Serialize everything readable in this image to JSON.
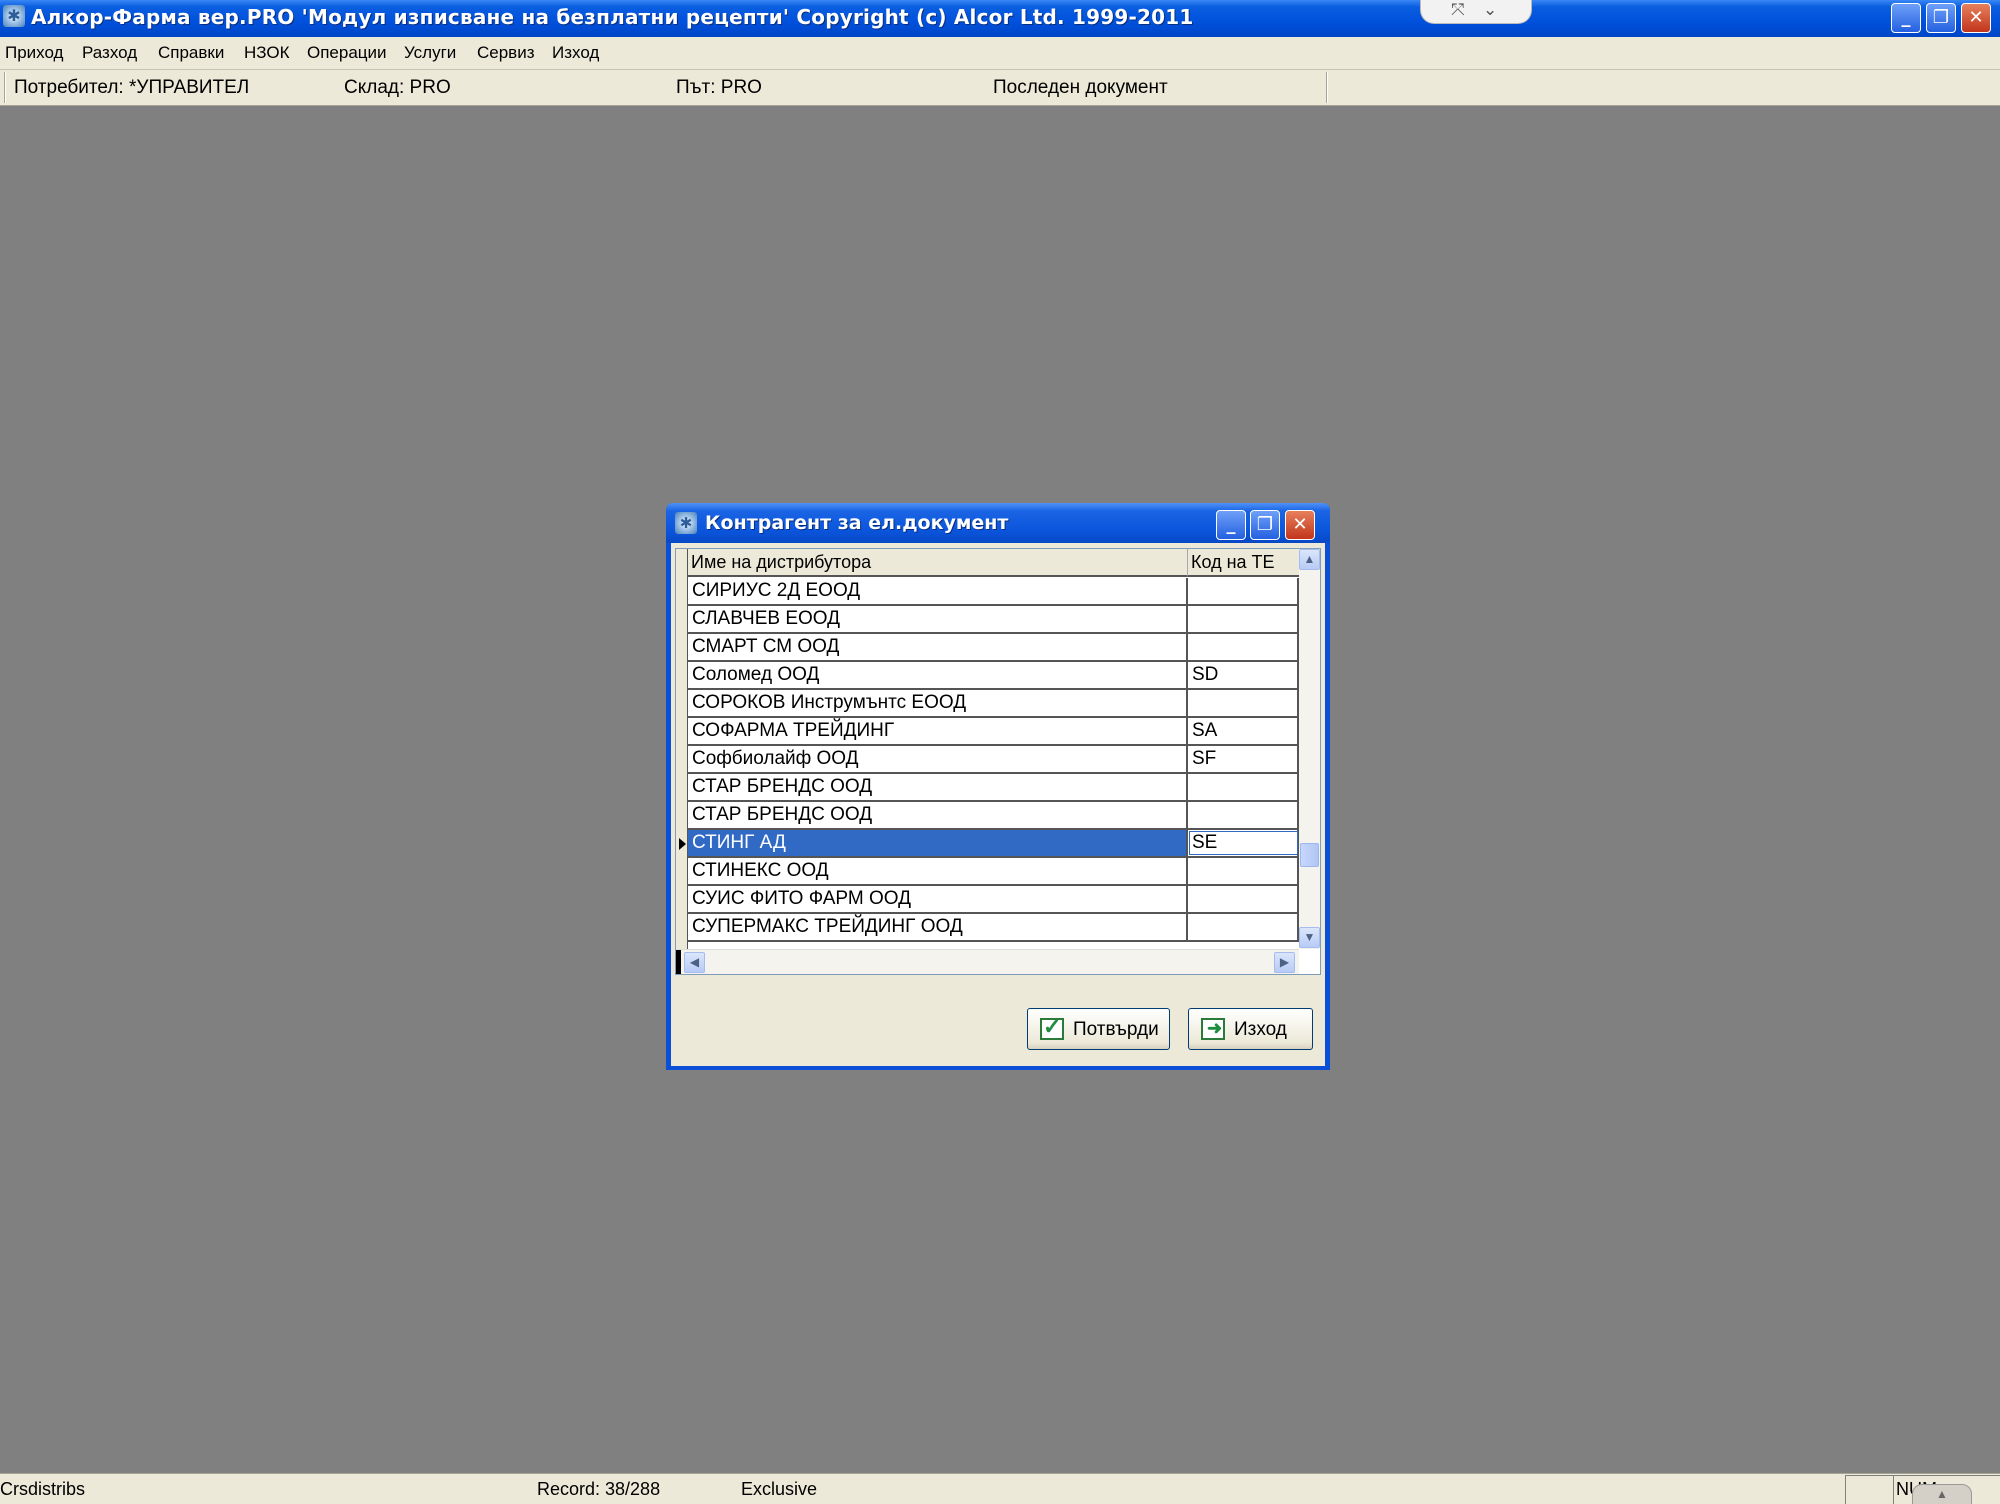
{
  "window": {
    "title": "Алкор-Фарма вер.PRO 'Модул изписване на безплатни рецепти' Copyright (c) Alcor Ltd. 1999-2011",
    "controls": {
      "minimize": "_",
      "maximize": "❐",
      "close": "✕"
    },
    "notch": {
      "left": "⤧",
      "right": "⌄"
    }
  },
  "menu": [
    "Приход",
    "Разход",
    "Справки",
    "НЗОК",
    "Операции",
    "Услуги",
    "Сервиз",
    "Изход"
  ],
  "info": {
    "user": "Потребител: *УПРАВИТЕЛ",
    "store": "Склад: PRO",
    "path": "Път: PRO",
    "last_doc": "Последен документ"
  },
  "dialog": {
    "title": "Контрагент за ел.документ",
    "columns": [
      "Име на дистрибутора",
      "Код на ТЕ"
    ],
    "rows": [
      {
        "name": "СИРИУС 2Д ЕООД",
        "code": ""
      },
      {
        "name": "СЛАВЧЕВ ЕООД",
        "code": ""
      },
      {
        "name": "СМАРТ СМ ООД",
        "code": ""
      },
      {
        "name": "Соломед ООД",
        "code": "SD"
      },
      {
        "name": "СОРОКОВ Инструмънтс ЕООД",
        "code": ""
      },
      {
        "name": "СОФАРМА ТРЕЙДИНГ",
        "code": "SA"
      },
      {
        "name": "Софбиолайф ООД",
        "code": "SF"
      },
      {
        "name": "СТАР БРЕНДС ООД",
        "code": ""
      },
      {
        "name": "СТАР БРЕНДС ООД",
        "code": ""
      },
      {
        "name": "СТИНГ  АД",
        "code": "SE"
      },
      {
        "name": "СТИНЕКС ООД",
        "code": ""
      },
      {
        "name": "СУИС ФИТО ФАРМ ООД",
        "code": ""
      },
      {
        "name": "СУПЕРМАКС ТРЕЙДИНГ ООД",
        "code": ""
      }
    ],
    "selected_row": 9,
    "confirm_label": "Потвърди",
    "exit_label": "Изход"
  },
  "status": {
    "table": "Crsdistribs",
    "record": "Record: 38/288",
    "mode": "Exclusive",
    "num": "NUM"
  },
  "colors": {
    "desktop": "#808080",
    "titlebar": "#0050dc",
    "selection": "#316ac5"
  }
}
